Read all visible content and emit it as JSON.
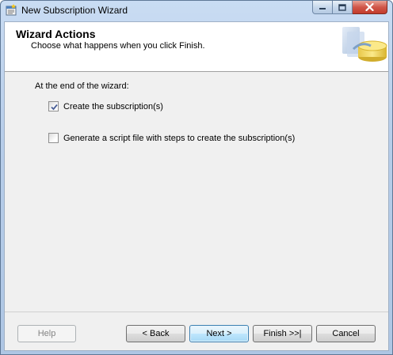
{
  "window": {
    "title": "New Subscription Wizard",
    "icons": {
      "app": "wizard-app-icon",
      "minimize": "minimize-icon",
      "maximize": "maximize-icon",
      "close": "close-icon"
    }
  },
  "header": {
    "title": "Wizard Actions",
    "subtitle": "Choose what happens when you click Finish.",
    "graphic": "database-cylinder-icon"
  },
  "content": {
    "lead": "At the end of the wizard:",
    "options": [
      {
        "label": "Create the subscription(s)",
        "checked": true
      },
      {
        "label": "Generate a script file with steps to create the subscription(s)",
        "checked": false
      }
    ]
  },
  "buttons": {
    "help": "Help",
    "back": "< Back",
    "next": "Next >",
    "finish": "Finish >>|",
    "cancel": "Cancel"
  }
}
